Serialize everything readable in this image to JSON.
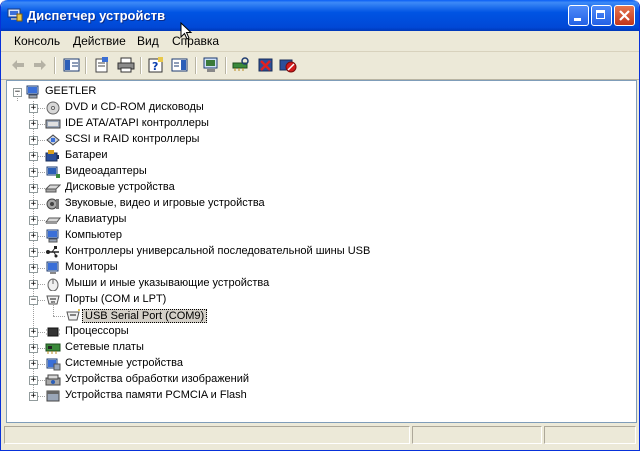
{
  "window": {
    "title": "Диспетчер устройств",
    "accent": "#0054e3"
  },
  "menu": [
    {
      "id": "console",
      "label": "Консоль"
    },
    {
      "id": "action",
      "label": "Действие"
    },
    {
      "id": "view",
      "label": "Вид"
    },
    {
      "id": "help",
      "label": "Справка"
    }
  ],
  "toolbar": [
    {
      "id": "back",
      "icon": "back-arrow-icon"
    },
    {
      "id": "forward",
      "icon": "forward-arrow-icon"
    },
    {
      "id": "show-hide-tree",
      "icon": "console-tree-icon"
    },
    {
      "id": "properties",
      "icon": "properties-icon"
    },
    {
      "id": "print",
      "icon": "printer-icon"
    },
    {
      "id": "help",
      "icon": "help-icon"
    },
    {
      "id": "action-pane",
      "icon": "action-pane-icon"
    },
    {
      "id": "update-driver",
      "icon": "update-driver-icon"
    },
    {
      "id": "scan-hardware",
      "icon": "scan-hardware-icon"
    },
    {
      "id": "uninstall",
      "icon": "uninstall-icon"
    },
    {
      "id": "disable",
      "icon": "disable-device-icon"
    }
  ],
  "tree": {
    "root": "GEETLER",
    "items": [
      {
        "label": "DVD и CD-ROM дисководы",
        "icon": "cdrom-icon",
        "expanded": false
      },
      {
        "label": "IDE ATA/ATAPI контроллеры",
        "icon": "ide-controller-icon",
        "expanded": false
      },
      {
        "label": "SCSI и RAID контроллеры",
        "icon": "scsi-controller-icon",
        "expanded": false
      },
      {
        "label": "Батареи",
        "icon": "battery-icon",
        "expanded": false
      },
      {
        "label": "Видеоадаптеры",
        "icon": "display-adapter-icon",
        "expanded": false
      },
      {
        "label": "Дисковые устройства",
        "icon": "disk-drive-icon",
        "expanded": false
      },
      {
        "label": "Звуковые, видео и игровые устройства",
        "icon": "sound-icon",
        "expanded": false
      },
      {
        "label": "Клавиатуры",
        "icon": "keyboard-icon",
        "expanded": false
      },
      {
        "label": "Компьютер",
        "icon": "computer-icon",
        "expanded": false
      },
      {
        "label": "Контроллеры универсальной последовательной шины USB",
        "icon": "usb-icon",
        "expanded": false
      },
      {
        "label": "Мониторы",
        "icon": "monitor-icon",
        "expanded": false
      },
      {
        "label": "Мыши и иные указывающие устройства",
        "icon": "mouse-icon",
        "expanded": false
      },
      {
        "label": "Порты (COM и LPT)",
        "icon": "port-icon",
        "expanded": true,
        "children": [
          {
            "label": "USB Serial Port (COM9)",
            "icon": "serial-port-icon",
            "selected": true
          }
        ]
      },
      {
        "label": "Процессоры",
        "icon": "processor-icon",
        "expanded": false
      },
      {
        "label": "Сетевые платы",
        "icon": "network-card-icon",
        "expanded": false
      },
      {
        "label": "Системные устройства",
        "icon": "system-device-icon",
        "expanded": false
      },
      {
        "label": "Устройства обработки изображений",
        "icon": "imaging-device-icon",
        "expanded": false
      },
      {
        "label": "Устройства памяти PCMCIA и Flash",
        "icon": "pcmcia-icon",
        "expanded": false
      }
    ]
  }
}
